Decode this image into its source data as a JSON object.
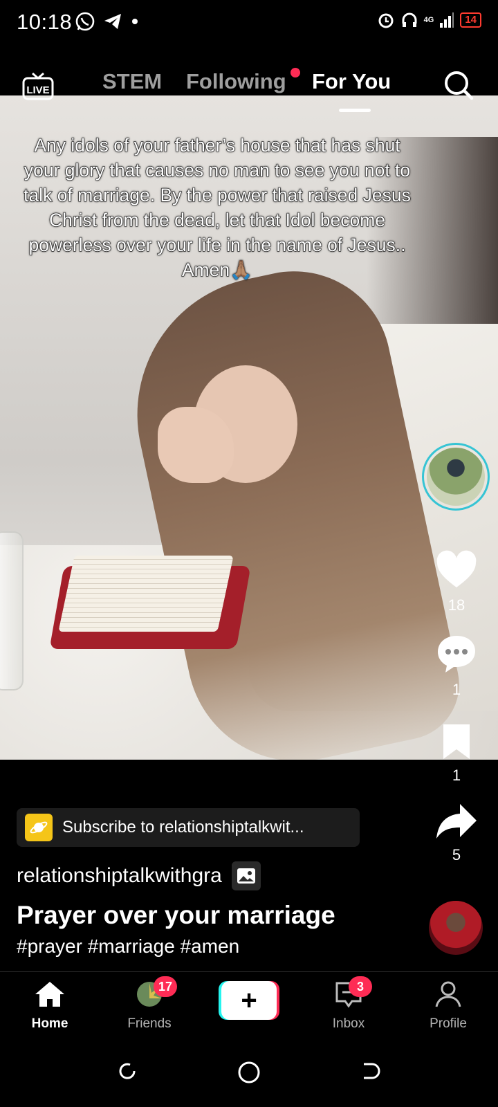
{
  "status": {
    "time": "10:18",
    "network": "4G",
    "battery": "14"
  },
  "topnav": {
    "live_label": "LIVE",
    "tabs": [
      {
        "label": "STEM"
      },
      {
        "label": "Following"
      },
      {
        "label": "For You"
      }
    ],
    "active_tab": "For You"
  },
  "post": {
    "caption": "Any idols of your father’s house that has shut your glory that causes no man to see you not to talk of marriage. By the power that raised Jesus Christ from the dead, let that Idol become powerless over your life in the name of Jesus.. Amen🙏🏽",
    "likes": "18",
    "comments": "1",
    "saves": "1",
    "shares": "5",
    "subscribe_text": "Subscribe to relationshiptalkwit...",
    "username": "relationshiptalkwithgra",
    "title": "Prayer over your marriage",
    "hashtags": "#prayer #marriage #amen"
  },
  "bottomnav": {
    "home": "Home",
    "friends": "Friends",
    "friends_badge": "17",
    "inbox": "Inbox",
    "inbox_badge": "3",
    "profile": "Profile"
  },
  "colors": {
    "accent": "#fe2c55",
    "cyan": "#25f4ee",
    "ring": "#36c4d4"
  }
}
